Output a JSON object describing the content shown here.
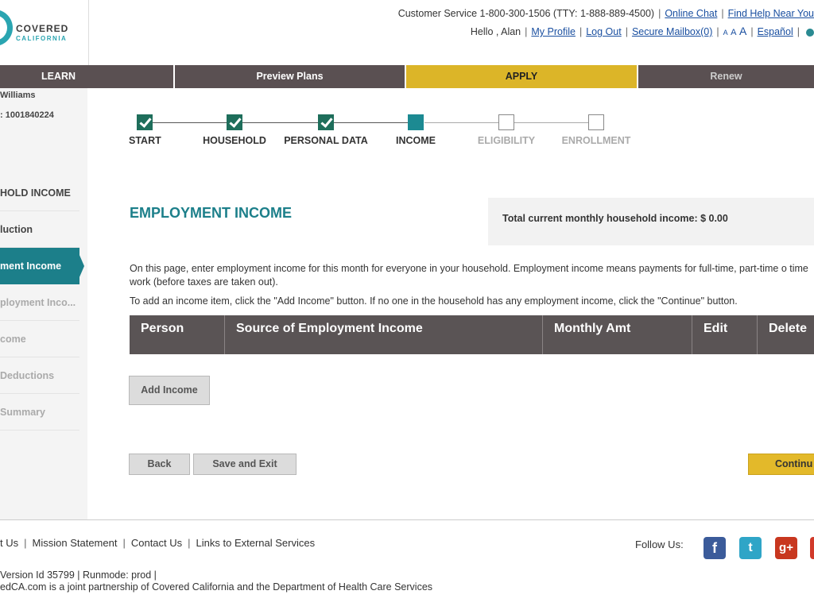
{
  "header": {
    "logo_text": "COVERED",
    "logo_sub": "CALIFORNIA",
    "customer_service": "Customer Service 1-800-300-1506 (TTY: 1-888-889-4500)",
    "online_chat": "Online Chat",
    "find_help": "Find Help Near You",
    "greeting": "Hello , Alan",
    "my_profile": "My Profile",
    "log_out": "Log Out",
    "secure_mailbox": "Secure Mailbox(0)",
    "font_small": "A",
    "font_medium": "A",
    "font_large": "A",
    "espanol": "Español"
  },
  "nav": {
    "learn": "LEARN",
    "preview": "Preview Plans",
    "apply": "APPLY",
    "renew": "Renew"
  },
  "sidebar": {
    "user_name": "Williams",
    "case_id": ": 1001840224",
    "items": [
      "HOLD INCOME",
      "luction",
      "ment Income",
      "ployment Inco...",
      "come",
      "Deductions",
      "Summary"
    ]
  },
  "progress": {
    "steps": [
      "START",
      "HOUSEHOLD",
      "PERSONAL DATA",
      "INCOME",
      "ELIGIBILITY",
      "ENROLLMENT"
    ]
  },
  "main": {
    "title": "EMPLOYMENT INCOME",
    "total_income": "Total current monthly household income: $ 0.00",
    "intro": "On this page, enter employment income for this month for everyone in your household. Employment income means payments for full-time, part-time o time work (before taxes are taken out).",
    "intro2": "To add an income item, click the \"Add Income\" button. If no one in the household has any employment income, click the \"Continue\" button.",
    "columns": [
      "Person",
      "Source of Employment Income",
      "Monthly Amt",
      "Edit",
      "Delete"
    ],
    "add_income": "Add Income",
    "back": "Back",
    "save_exit": "Save and Exit",
    "continue": "Continu"
  },
  "footer": {
    "links": [
      "t Us",
      "Mission Statement",
      "Contact Us",
      "Links to External Services"
    ],
    "follow_us": "Follow Us:",
    "social": [
      "facebook-icon",
      "twitter-icon",
      "google-plus-icon",
      "youtube-icon"
    ],
    "version": "Version Id 35799  |   Runmode: prod  |",
    "partner": "edCA.com is a joint partnership of Covered California and the Department of Health Care Services"
  }
}
